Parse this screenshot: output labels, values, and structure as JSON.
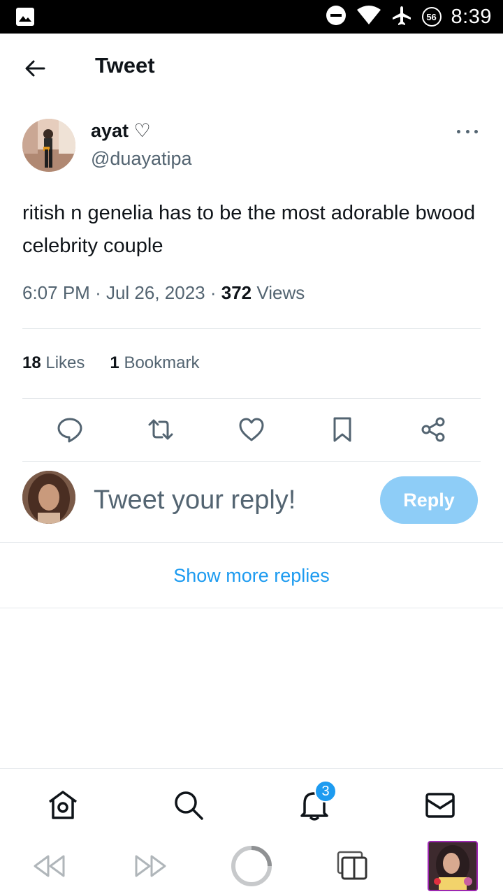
{
  "status_bar": {
    "time": "8:39",
    "badge": "56",
    "icons": [
      "image-icon",
      "dnd-icon",
      "wifi-icon",
      "airplane-icon"
    ]
  },
  "header": {
    "title": "Tweet",
    "back_icon": "arrow-left-icon"
  },
  "tweet": {
    "author_name": "ayat ♡",
    "author_handle": "@duayatipa",
    "text": "ritish n genelia has to be the most adorable bwood celebrity couple",
    "time": "6:07 PM",
    "date": "Jul 26, 2023",
    "views_count": "372",
    "views_label": "Views",
    "likes_count": "18",
    "likes_label": "Likes",
    "bookmarks_count": "1",
    "bookmarks_label": "Bookmark"
  },
  "actions": [
    "reply-icon",
    "retweet-icon",
    "like-icon",
    "bookmark-icon",
    "share-icon"
  ],
  "reply": {
    "placeholder": "Tweet your reply!",
    "button_label": "Reply"
  },
  "show_more_label": "Show more replies",
  "bottom_nav": {
    "items": [
      "home-icon",
      "search-icon",
      "notifications-icon",
      "messages-icon"
    ],
    "notifications_badge": "3"
  },
  "browser_bar": {
    "items": [
      "rewind-icon",
      "fast-forward-icon",
      "loading-icon",
      "tabs-icon"
    ]
  },
  "colors": {
    "accent": "#1d9bf0",
    "reply_button": "#8ecdf7",
    "secondary_text": "#536471"
  }
}
